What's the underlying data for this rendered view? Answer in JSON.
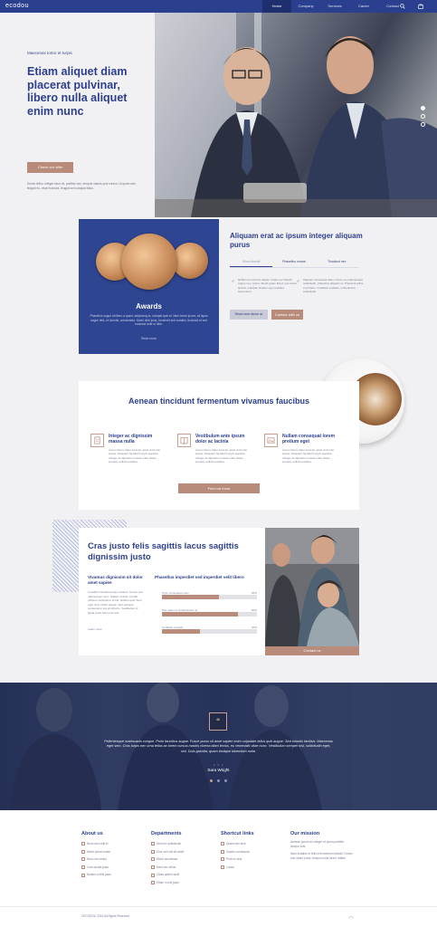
{
  "nav": {
    "logo": "ecodou",
    "items": [
      {
        "label": "Home",
        "active": true
      },
      {
        "label": "Company"
      },
      {
        "label": "Services"
      },
      {
        "label": "Career"
      },
      {
        "label": "Contact"
      }
    ]
  },
  "hero": {
    "eyebrow": "Maecenas tortor et turpis",
    "heading": "Etiam aliquet diam placerat pulvinar, libero nulla aliquet enim nunc",
    "button": "Check our offer",
    "paragraph": "Donec tellus. Integer risus mi, porttitor non, tempus mauris quis cursus. Ut quam sed, feugiat eu, vitae tincidunt, feugiat sed volutpat listus.",
    "slider_dots": 3,
    "active_dot": 1
  },
  "awards": {
    "title": "Awards",
    "paragraph": "Phasellus augue at libero a quam, adipiscing at, volutpat quis et. Nam lorem ipsum, sit ligula augue felis, et lobortis, consectetur. Morbi nibh justo, hendrerit sed sodales, tincidunt et sed euismod ante ut nibh.",
    "link": "Read more"
  },
  "about": {
    "heading": "Aliquam erat ac ipsum integer aliquam purus",
    "tabs": [
      "Etiam blandit",
      "Phasellus ornare",
      "Tincidunt nec"
    ],
    "active_tab": 0,
    "col1": "Nullam fermentum sapien turpis nec blandit, augue nec, lorem. Morbi quam libero non lorem lacinia, volutpat. Nullam eget sodales fermentum.",
    "col2": "Aliquam consequat diam, lorem eu pellentesque sollicitudin, phasellus aliquam et. Praesent tellus et pretium. Curabitur sodales, nulla lacinia sollicitudin.",
    "btn_grey": "Read more about us",
    "btn_tan": "Contact with us"
  },
  "features": {
    "heading": "Aenean tincidunt fermentum vivamus faucibus",
    "items": [
      {
        "icon": "document-icon",
        "title": "Integer ac dignissim massa nulla",
        "text": "Lorem ipsum dolor sit amet, justo ut fis nisl augue. Praesent hendrerit turpis egestas. Integer ac dignissim massa nulla. Etiam posuere sollicit tincidunt."
      },
      {
        "icon": "book-icon",
        "title": "Vestibulum ante ipsum dolor ac lacinia",
        "text": "Lorem ipsum dolor sit amet, justo ut fis nisl augue. Praesent hendrerit turpis egestas. Integer ac dignissim massa nulla. Etiam posuere sollicit tincidunt."
      },
      {
        "icon": "image-icon",
        "title": "Nullam consequat lorem pretium eget",
        "text": "Lorem ipsum dolor sit amet, justo ut fis nisl augue. Praesent hendrerit turpis egestas. Integer ac dignissim massa nulla. Etiam posuere sollicit tincidunt."
      }
    ],
    "button": "Find out more"
  },
  "skills": {
    "heading": "Cras justo felis sagittis lacus sagittis dignissim justo",
    "left_heading": "Vivamus dignissim sit dolor amet sapien",
    "left_text": "Curabitur blandit tempus ultrices. Donec sed ullamcorper sem. Nullam id dolor id nibh ultricies vehicula ut id elit. Nullam quis risus eget urna mollis ornare. Sed posuere consectetur est at lobortis. Vestibulum id ligula porta felis euismod.",
    "left_link": "Learn more",
    "right_heading": "Phasellus imperdiet sed imperdiet velit libero",
    "bars": [
      {
        "label": "Proin consequat lorem",
        "percent": 60
      },
      {
        "label": "Sed quam ut condimentum at",
        "percent": 80
      },
      {
        "label": "Curabitur suscipit",
        "percent": 40
      }
    ],
    "photo_button": "Contact us"
  },
  "testimonial": {
    "quote": "Pellentesque malesuada congue. Proin faucibus augue. Fusce purus sit amet sapien enim vulputate tellus quis augue. Sed lobortis facilisis. Maecenas eget sem. Cras turpis nec urna tellus ac lorem cursus mauris viverra diam lectus, eu venenatis vitae nunc. Vestibulum semper nisl, sollicitudin eget, nisl. Duis gravida, quam tristique bibendum nulla.",
    "name": "Sara Wright",
    "dots": 3,
    "active_dot": 0
  },
  "footer": {
    "about": {
      "title": "About us",
      "items": [
        "Nunc sed velit id",
        "Morbi ipsum lorem",
        "Nunc nec tellus",
        "Cras iaculis justo",
        "Nullam a felis justo"
      ]
    },
    "departments": {
      "title": "Departments",
      "items": [
        "Sed nec sollicitudin",
        "Duis sed nisl sit amet",
        "Morbi accumsan",
        "Nam nec tellus",
        "Class aptent taciti",
        "Etiam in nisl justo"
      ]
    },
    "shortcuts": {
      "title": "Shortcut links",
      "items": [
        "Quam nec sem",
        "Sapien consequat",
        "Proin in erat",
        "Lorem"
      ]
    },
    "mission": {
      "title": "Our mission",
      "p1": "Aenean ipsum ac integer et purus porttitor tempor erat.",
      "p2": "Nam sodales et felis a fermentum blandit. Donec non lorem porta, tempus nulla lorem mattis."
    },
    "copyright": "©ECODOU 2019 All Rights Reserved"
  },
  "colors": {
    "primary": "#2b3f8f",
    "accent": "#b98b7a",
    "background": "#f1f1f3"
  }
}
